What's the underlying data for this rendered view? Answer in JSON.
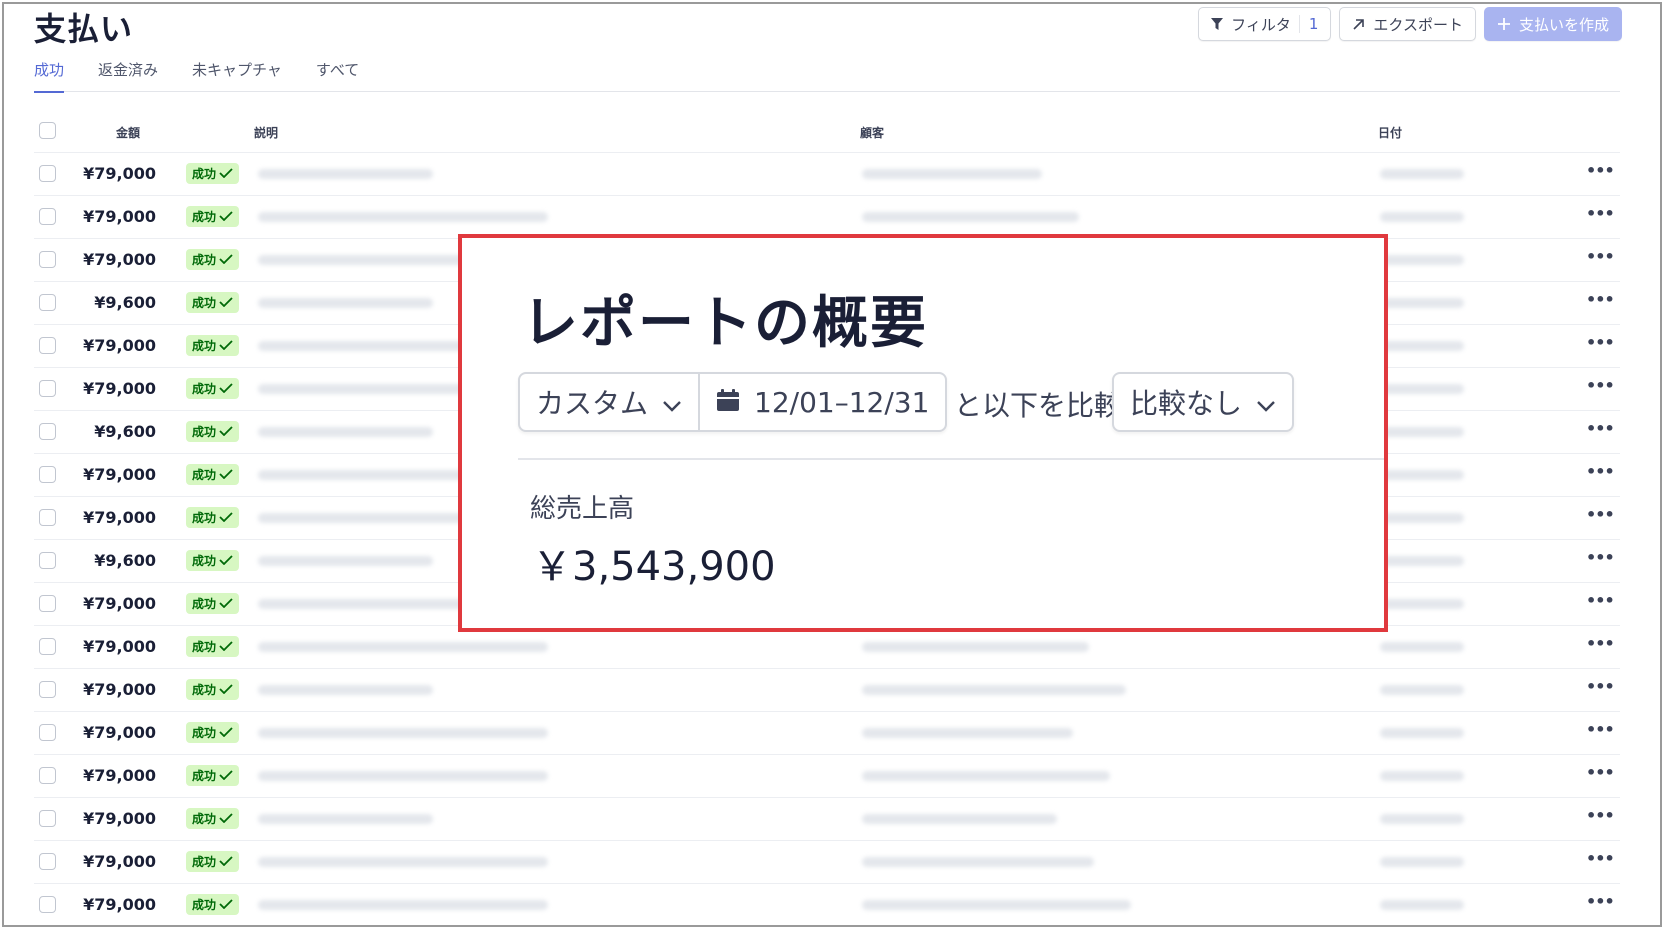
{
  "page": {
    "title": "支払い"
  },
  "actions": {
    "filter_label": "フィルタ",
    "filter_count": "1",
    "export_label": "エクスポート",
    "create_label": "支払いを作成"
  },
  "tabs": [
    {
      "label": "成功",
      "active": true
    },
    {
      "label": "返金済み",
      "active": false
    },
    {
      "label": "未キャプチャ",
      "active": false
    },
    {
      "label": "すべて",
      "active": false
    }
  ],
  "table": {
    "columns": {
      "amount": "金額",
      "description": "説明",
      "customer": "顧客",
      "date": "日付"
    },
    "status_label": "成功",
    "rows": [
      {
        "amount": "¥79,000"
      },
      {
        "amount": "¥79,000"
      },
      {
        "amount": "¥79,000"
      },
      {
        "amount": "¥9,600"
      },
      {
        "amount": "¥79,000"
      },
      {
        "amount": "¥79,000"
      },
      {
        "amount": "¥9,600"
      },
      {
        "amount": "¥79,000"
      },
      {
        "amount": "¥79,000"
      },
      {
        "amount": "¥9,600"
      },
      {
        "amount": "¥79,000"
      },
      {
        "amount": "¥79,000"
      },
      {
        "amount": "¥79,000"
      },
      {
        "amount": "¥79,000"
      },
      {
        "amount": "¥79,000"
      },
      {
        "amount": "¥79,000"
      },
      {
        "amount": "¥79,000"
      },
      {
        "amount": "¥79,000"
      }
    ]
  },
  "report": {
    "title": "レポートの概要",
    "range_preset": "カスタム",
    "date_range": "12/01–12/31",
    "compare_label": "と以下を比較:",
    "compare_value": "比較なし",
    "metric_label": "総売上高",
    "metric_value": "￥3,543,900"
  },
  "colors": {
    "accent": "#5469d4",
    "success_bg": "#d7f7c2",
    "success_text": "#006908",
    "highlight_border": "#e0393e",
    "primary_button_disabled": "#a9b4f0"
  }
}
